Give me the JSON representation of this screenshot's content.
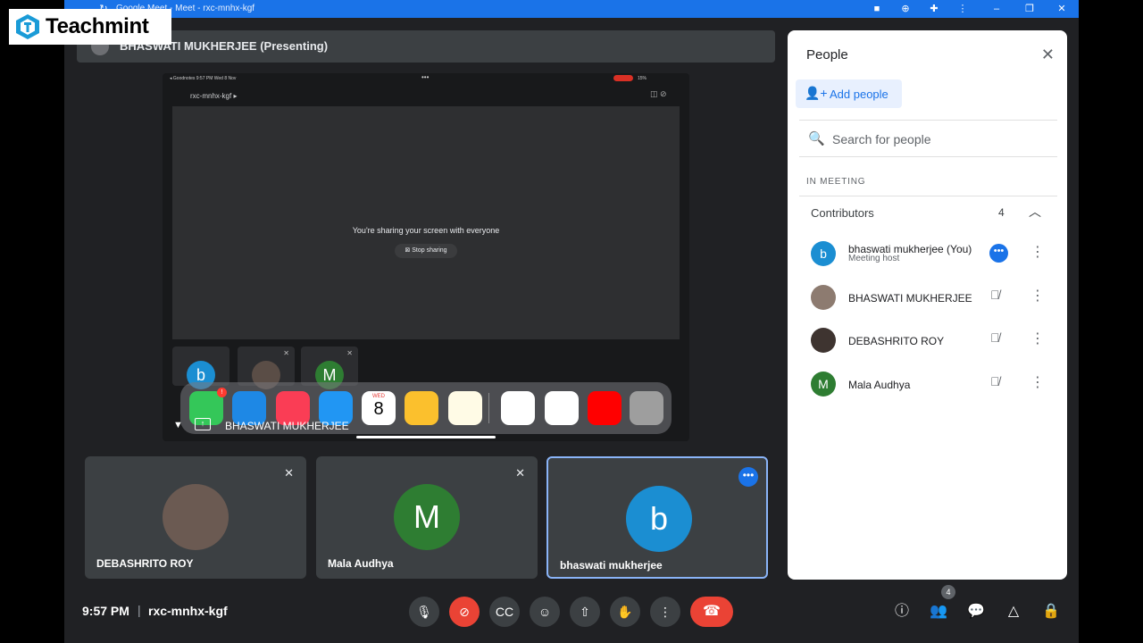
{
  "window": {
    "title": "Google Meet - Meet - rxc-mnhx-kgf"
  },
  "logo": {
    "text": "Teachmint"
  },
  "presenting_bar": {
    "name": "BHASWATI MUKHERJEE (Presenting)"
  },
  "shared_screen": {
    "status_left": "◂ Goodnotes  9:57 PM  Wed 8 Nov",
    "status_right": "15%",
    "meeting_code": "rxc-mnhx-kgf ▸",
    "message": "You're sharing your screen with everyone",
    "stop_sharing": "Stop sharing",
    "mini_tiles": [
      "b",
      "",
      "M"
    ],
    "calendar_day": "WED",
    "calendar_date": "8",
    "presenter_label": "BHASWATI MUKHERJEE",
    "messages_badge": "!"
  },
  "tiles": [
    {
      "name": "DEBASHRITO ROY",
      "initial": ""
    },
    {
      "name": "Mala Audhya",
      "initial": "M"
    },
    {
      "name": "bhaswati mukherjee",
      "initial": "b"
    }
  ],
  "people_panel": {
    "title": "People",
    "add_people": "Add people",
    "search_placeholder": "Search for people",
    "in_meeting": "IN MEETING",
    "contributors_label": "Contributors",
    "contributors_count": "4",
    "people": [
      {
        "name": "bhaswati mukherjee (You)",
        "sub": "Meeting host",
        "initial": "b"
      },
      {
        "name": "BHASWATI MUKHERJEE",
        "sub": "",
        "initial": ""
      },
      {
        "name": "DEBASHRITO ROY",
        "sub": "",
        "initial": ""
      },
      {
        "name": "Mala Audhya",
        "sub": "",
        "initial": "M"
      }
    ]
  },
  "bottom_bar": {
    "time": "9:57 PM",
    "separator": "|",
    "meeting_code": "rxc-mnhx-kgf",
    "people_count": "4"
  },
  "colors": {
    "accent": "#1a73e8",
    "leave_red": "#ea4335",
    "mala_green": "#2e7d32",
    "bhaswati_blue": "#1b8ed2"
  }
}
